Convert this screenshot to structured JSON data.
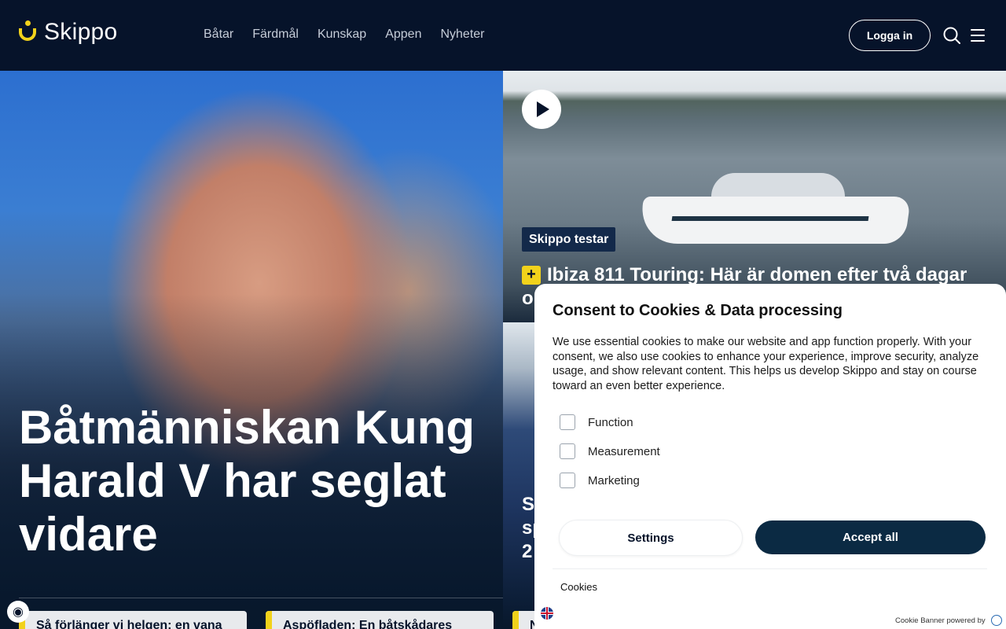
{
  "brand": {
    "name": "Skippo",
    "accent_color": "#f2d21b",
    "navy": "#06132a"
  },
  "nav": {
    "items": [
      "Båtar",
      "Färdmål",
      "Kunskap",
      "Appen",
      "Nyheter"
    ]
  },
  "header": {
    "login_label": "Logga in",
    "search_icon": "search-icon",
    "menu_icon": "hamburger-menu-icon"
  },
  "hero": {
    "title": "Båtmänniskan Kung Harald V har seglat vidare"
  },
  "feature": {
    "tag": "Skippo testar",
    "plus_badge": "+",
    "headline_line1": "Ibiza 811 Touring: Här är domen efter två dagar",
    "headline_line2": "o"
  },
  "feature2": {
    "partial_lines": [
      "S",
      "sp",
      "2"
    ]
  },
  "cards": [
    {
      "text": "Så förlänger vi helgen: en vana"
    },
    {
      "text": "Aspöfladen: En båtskådares"
    },
    {
      "text": "N"
    }
  ],
  "consent": {
    "title": "Consent to Cookies & Data processing",
    "body": "We use essential cookies to make our website and app function properly. With your consent, we also use cookies to enhance your experience, improve security, analyze usage, and show relevant content. This helps us develop Skippo and stay on course toward an even better experience.",
    "options": [
      "Function",
      "Measurement",
      "Marketing"
    ],
    "settings_label": "Settings",
    "accept_label": "Accept all",
    "cookies_link": "Cookies",
    "powered_by": "Cookie Banner powered by"
  }
}
